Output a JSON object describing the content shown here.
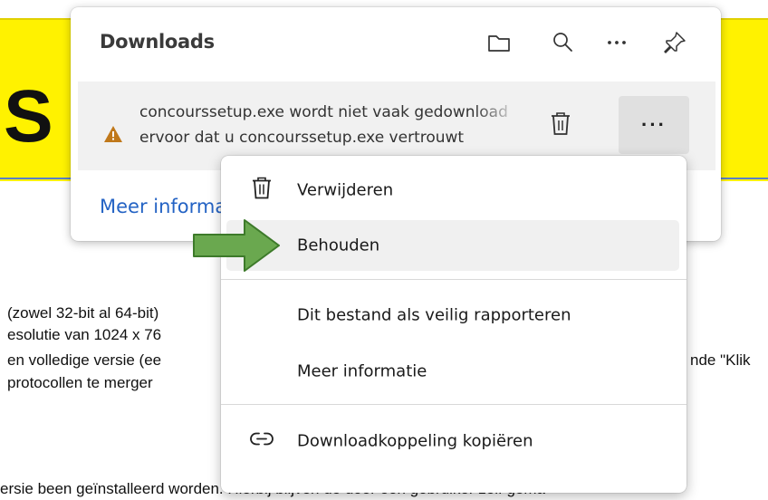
{
  "background_page": {
    "banner_letter": "S",
    "lines": [
      "(zowel 32-bit al 64-bit)",
      "esolutie van 1024 x 76",
      "en volledige versie (ee",
      " protocollen te merger",
      "nde \"Klik",
      "ersie been geïnstalleerd worden. Hierbij blijven de door een gebruiker zelf gema"
    ]
  },
  "downloads": {
    "title": "Downloads",
    "header_icons": [
      "folder-icon",
      "search-icon",
      "more-icon",
      "pin-icon"
    ],
    "item": {
      "line1": "concourssetup.exe wordt niet vaak gedownload",
      "line2": "ervoor dat u concourssetup.exe vertrouwt",
      "more_label": "···"
    },
    "more_info_link": "Meer informatie"
  },
  "context_menu": {
    "items": [
      {
        "label": "Verwijderen",
        "icon": "trash-icon"
      },
      {
        "label": "Behouden",
        "icon": ""
      },
      {
        "label": "Dit bestand als veilig rapporteren",
        "icon": ""
      },
      {
        "label": "Meer informatie",
        "icon": ""
      },
      {
        "label": "Downloadkoppeling kopiëren",
        "icon": "link-icon"
      }
    ]
  },
  "colors": {
    "banner": "#fff200",
    "link": "#2463c4",
    "warning": "#c0781a",
    "arrow": "#6aa84f"
  }
}
